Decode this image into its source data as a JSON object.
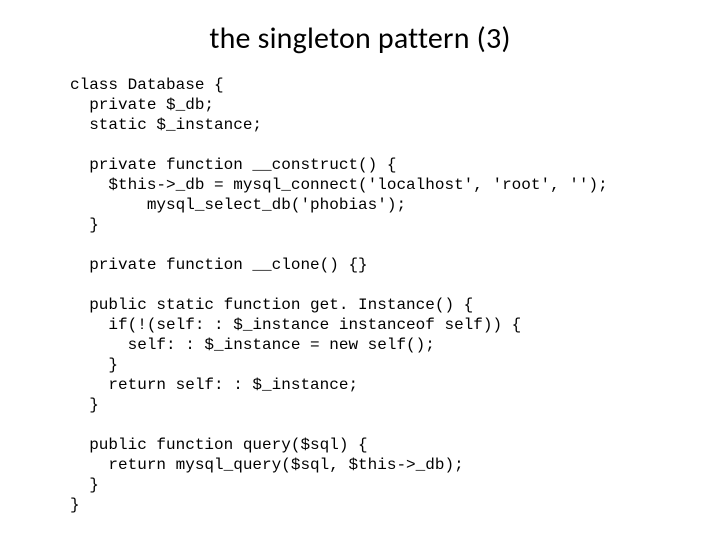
{
  "title": "the singleton pattern (3)",
  "code": "class Database {\n  private $_db;\n  static $_instance;\n\n  private function __construct() {\n    $this->_db = mysql_connect('localhost', 'root', '');\n        mysql_select_db('phobias');\n  }\n\n  private function __clone() {}\n\n  public static function get. Instance() {\n    if(!(self: : $_instance instanceof self)) {\n      self: : $_instance = new self();\n    }\n    return self: : $_instance;\n  }\n\n  public function query($sql) {\n    return mysql_query($sql, $this->_db);\n  }\n}"
}
